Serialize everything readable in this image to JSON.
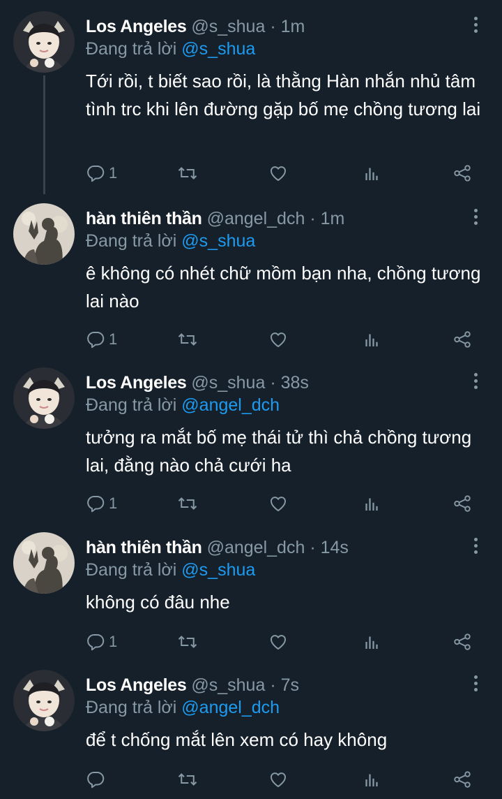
{
  "reply_prefix": "Đang trả lời",
  "tweets": [
    {
      "name": "Los Angeles",
      "handle": "@s_shua",
      "dot": "·",
      "time": "1m",
      "reply_to": "@s_shua",
      "text": "Tới rồi, t biết sao rồi, là thằng Hàn nhắn nhủ tâm tình trc khi lên đường gặp bố mẹ chồng tương lai",
      "reply_count": "1",
      "avatar": "los-angeles"
    },
    {
      "name": "hàn thiên thần",
      "handle": "@angel_dch",
      "dot": "·",
      "time": "1m",
      "reply_to": "@s_shua",
      "text": "ê không có nhét chữ mồm bạn nha, chồng tương lai nào",
      "reply_count": "1",
      "avatar": "han-thien-than"
    },
    {
      "name": "Los Angeles",
      "handle": "@s_shua",
      "dot": "·",
      "time": "38s",
      "reply_to": "@angel_dch",
      "text": "tưởng ra mắt bố mẹ thái tử thì chả chồng tương lai, đằng nào chả cưới ha",
      "reply_count": "1",
      "avatar": "los-angeles"
    },
    {
      "name": "hàn thiên thần",
      "handle": "@angel_dch",
      "dot": "·",
      "time": "14s",
      "reply_to": "@s_shua",
      "text": "không có đâu nhe",
      "reply_count": "1",
      "avatar": "han-thien-than"
    },
    {
      "name": "Los Angeles",
      "handle": "@s_shua",
      "dot": "·",
      "time": "7s",
      "reply_to": "@angel_dch",
      "text": "để t chống mắt lên xem có hay không",
      "reply_count": "",
      "avatar": "los-angeles"
    }
  ],
  "colors": {
    "background": "#15202b",
    "muted": "#8899a6",
    "link": "#1d9bf0",
    "thread_line": "#38444d"
  },
  "icons": [
    "reply-icon",
    "retweet-icon",
    "like-icon",
    "analytics-icon",
    "share-icon",
    "more-icon"
  ]
}
